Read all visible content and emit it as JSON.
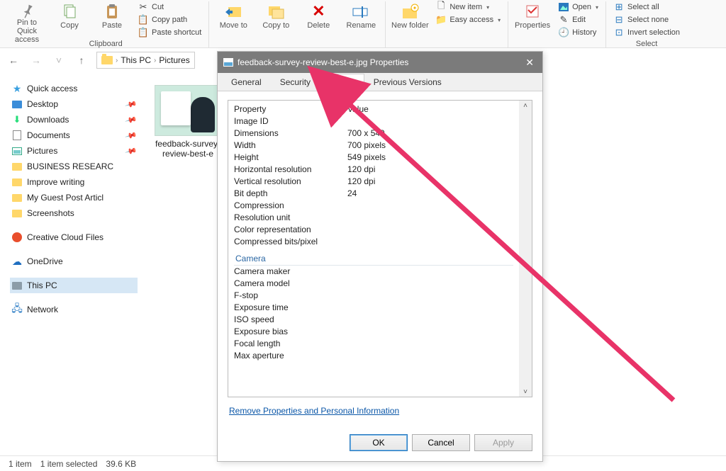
{
  "ribbon": {
    "pin": "Pin to Quick access",
    "copy": "Copy",
    "paste": "Paste",
    "cut": "Cut",
    "copy_path": "Copy path",
    "paste_shortcut": "Paste shortcut",
    "clipboard_label": "Clipboard",
    "move": "Move to",
    "copy_to": "Copy to",
    "delete": "Delete",
    "rename": "Rename",
    "new_folder": "New folder",
    "new_item": "New item",
    "easy_access": "Easy access",
    "properties": "Properties",
    "open": "Open",
    "edit": "Edit",
    "history": "History",
    "select_all": "Select all",
    "select_none": "Select none",
    "invert": "Invert selection",
    "select_label": "Select"
  },
  "breadcrumb": {
    "pc": "This PC",
    "folder": "Pictures"
  },
  "sidebar": {
    "quick": "Quick access",
    "desktop": "Desktop",
    "downloads": "Downloads",
    "documents": "Documents",
    "pictures": "Pictures",
    "biz": "BUSINESS RESEARC",
    "improve": "Improve writing",
    "guest": "My Guest Post Articl",
    "screens": "Screenshots",
    "cc": "Creative Cloud Files",
    "onedrive": "OneDrive",
    "thispc": "This PC",
    "network": "Network"
  },
  "file": {
    "name": "feedback-survey-review-best-e"
  },
  "status": {
    "count": "1 item",
    "sel": "1 item selected",
    "size": "39.6 KB"
  },
  "dialog": {
    "title": "feedback-survey-review-best-e.jpg Properties",
    "tabs": {
      "general": "General",
      "security": "Security",
      "details": "Details",
      "prev": "Previous Versions"
    },
    "head_prop": "Property",
    "head_val": "Value",
    "rows": [
      {
        "k": "Image ID",
        "v": ""
      },
      {
        "k": "Dimensions",
        "v": "700 x 549"
      },
      {
        "k": "Width",
        "v": "700 pixels"
      },
      {
        "k": "Height",
        "v": "549 pixels"
      },
      {
        "k": "Horizontal resolution",
        "v": "120 dpi"
      },
      {
        "k": "Vertical resolution",
        "v": "120 dpi"
      },
      {
        "k": "Bit depth",
        "v": "24"
      },
      {
        "k": "Compression",
        "v": ""
      },
      {
        "k": "Resolution unit",
        "v": ""
      },
      {
        "k": "Color representation",
        "v": ""
      },
      {
        "k": "Compressed bits/pixel",
        "v": ""
      }
    ],
    "camera_head": "Camera",
    "camera_rows": [
      "Camera maker",
      "Camera model",
      "F-stop",
      "Exposure time",
      "ISO speed",
      "Exposure bias",
      "Focal length",
      "Max aperture"
    ],
    "link": "Remove Properties and Personal Information",
    "ok": "OK",
    "cancel": "Cancel",
    "apply": "Apply"
  }
}
